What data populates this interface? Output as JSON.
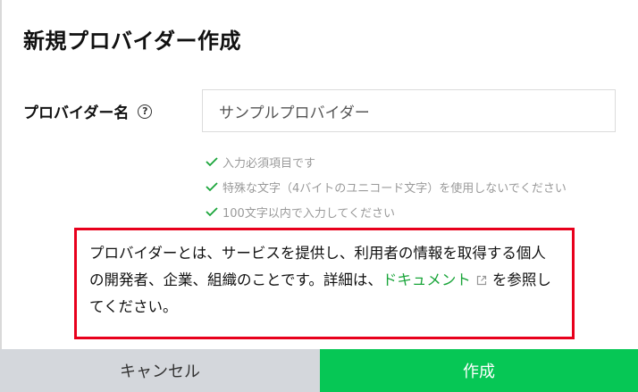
{
  "dialog": {
    "title": "新規プロバイダー作成"
  },
  "form": {
    "provider_name_label": "プロバイダー名",
    "help_icon_glyph": "?",
    "provider_name_value": "サンプルプロバイダー",
    "validations": [
      "入力必須項目です",
      "特殊な文字（4バイトのユニコード文字）を使用しないでください",
      "100文字以内で入力してください"
    ]
  },
  "notice": {
    "text_before_link": "プロバイダーとは、サービスを提供し、利用者の情報を取得する個人の開発者、企業、組織のことです。詳細は、",
    "link_text": "ドキュメント",
    "text_after_link": "を参照してください。"
  },
  "footer": {
    "cancel_label": "キャンセル",
    "create_label": "作成"
  },
  "colors": {
    "accent_green": "#06c755",
    "check_green": "#1aa53a",
    "highlight_red": "#e8001c",
    "cancel_gray": "#d4d7dc"
  },
  "icons": [
    "help-circle-icon",
    "checkmark-icon",
    "external-link-icon"
  ]
}
